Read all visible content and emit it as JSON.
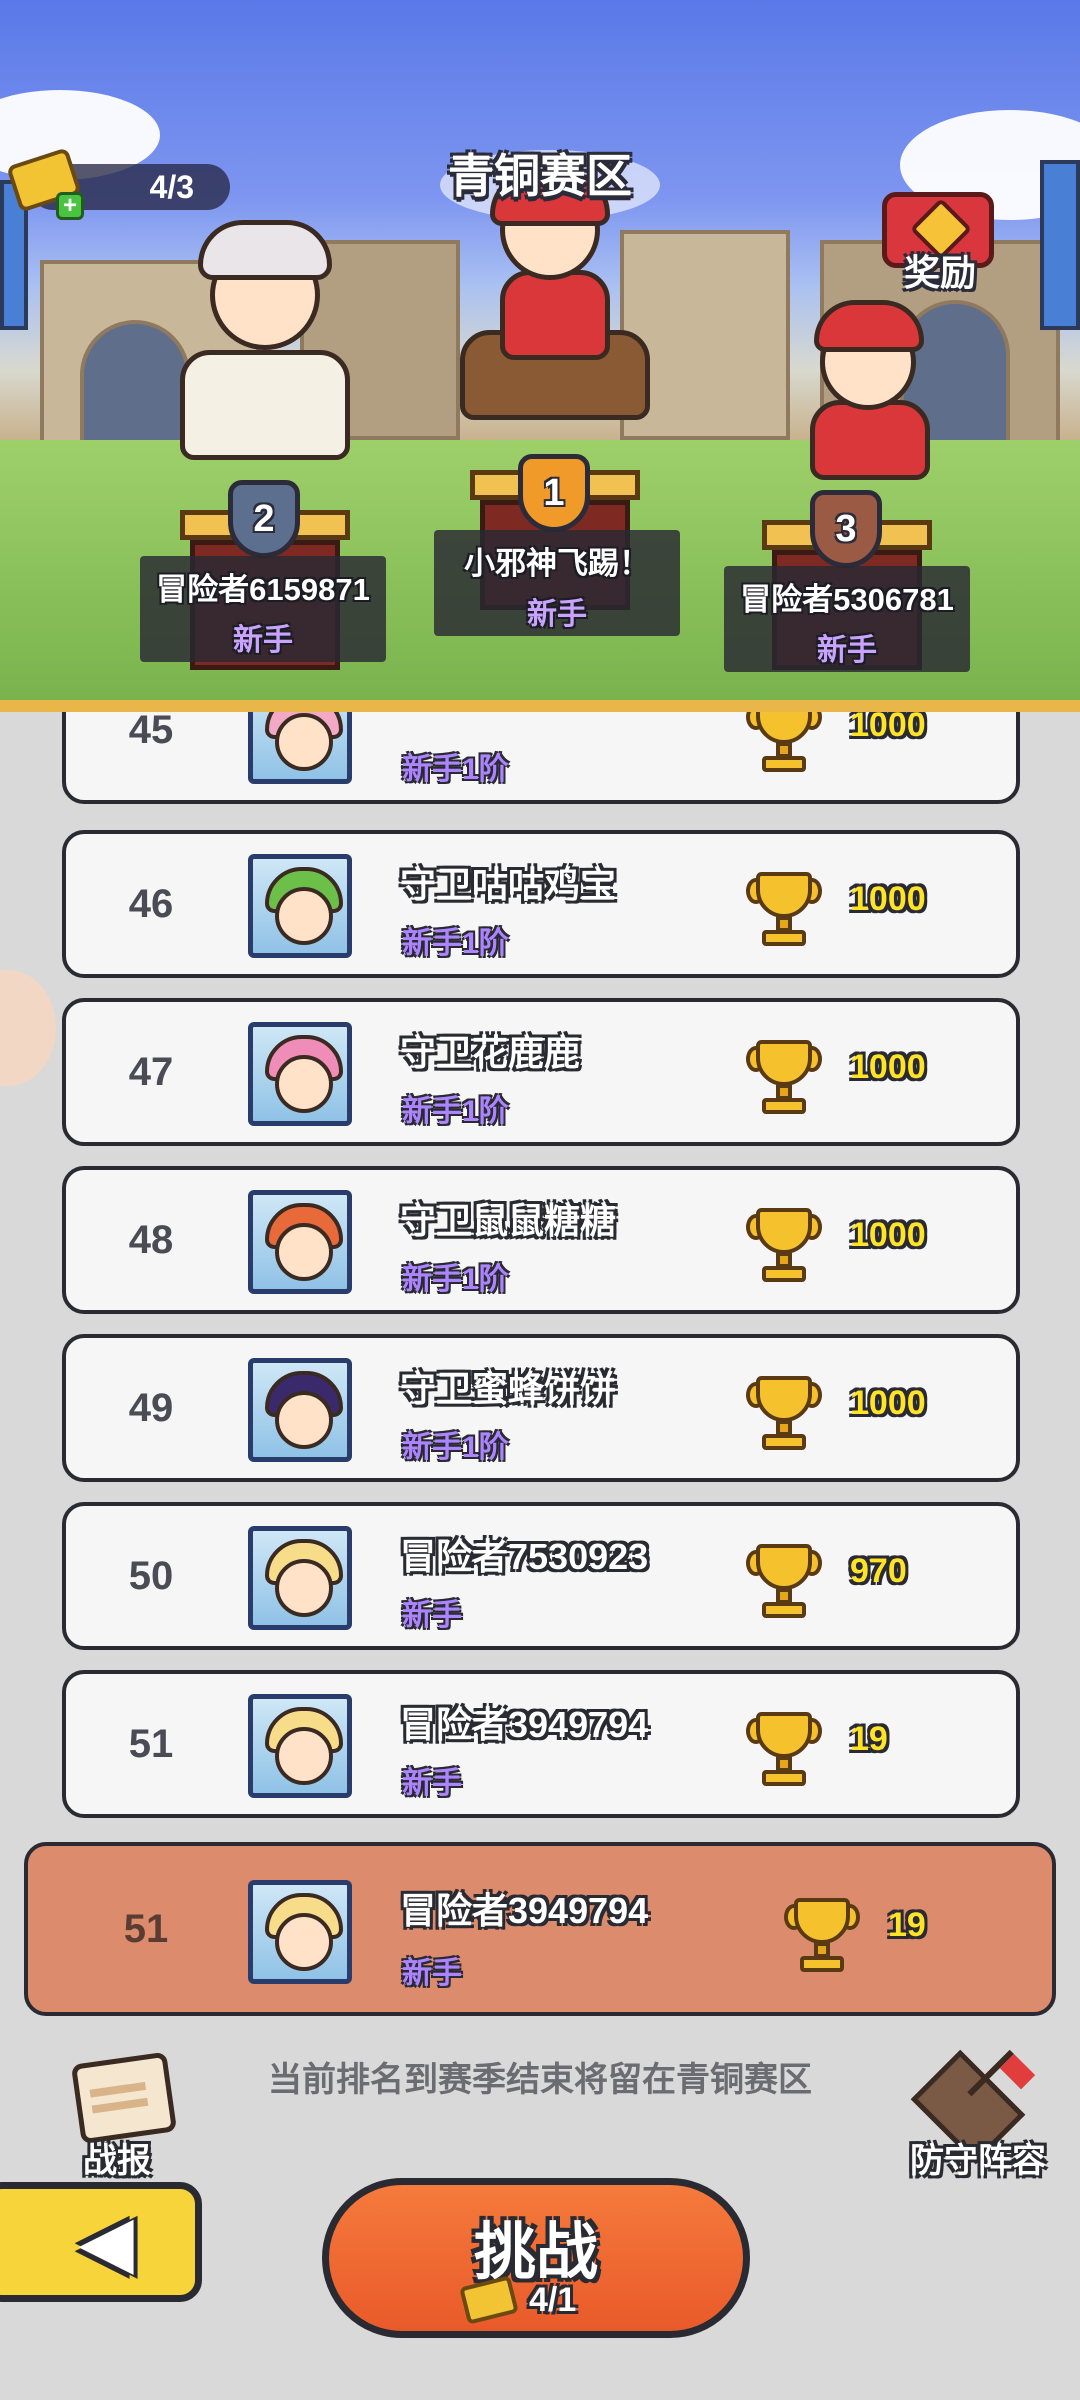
{
  "header": {
    "zone_title": "青铜赛区",
    "tickets": "4/3",
    "reward_label": "奖励"
  },
  "podium": [
    {
      "rank": "2",
      "name": "冒险者6159871",
      "tier": "新手"
    },
    {
      "rank": "1",
      "name": "小邪神飞踢！",
      "tier": "新手"
    },
    {
      "rank": "3",
      "name": "冒险者5306781",
      "tier": "新手"
    }
  ],
  "rows": [
    {
      "rank": "45",
      "name": "",
      "tier": "新手1阶",
      "score": "1000"
    },
    {
      "rank": "46",
      "name": "守卫咕咕鸡宝",
      "tier": "新手1阶",
      "score": "1000"
    },
    {
      "rank": "47",
      "name": "守卫花鹿鹿",
      "tier": "新手1阶",
      "score": "1000"
    },
    {
      "rank": "48",
      "name": "守卫鼠鼠糖糖",
      "tier": "新手1阶",
      "score": "1000"
    },
    {
      "rank": "49",
      "name": "守卫蜜蜂饼饼",
      "tier": "新手1阶",
      "score": "1000"
    },
    {
      "rank": "50",
      "name": "冒险者7530923",
      "tier": "新手",
      "score": "970"
    },
    {
      "rank": "51",
      "name": "冒险者3949794",
      "tier": "新手",
      "score": "19"
    }
  ],
  "self": {
    "rank": "51",
    "name": "冒险者3949794",
    "tier": "新手",
    "score": "19"
  },
  "footer": {
    "notice": "当前排名到赛季结束将留在青铜赛区",
    "report_label": "战报",
    "defense_label": "防守阵容",
    "challenge_label": "挑战",
    "challenge_cost": "4/1"
  },
  "colors": {
    "self_row_bg": "#dc8c6c",
    "challenge_button": "#e95a2a",
    "back_button": "#f6d43a",
    "tier_text": "#ad84ff",
    "score_text": "#ffe326"
  },
  "icons": [
    "ticket-icon",
    "treasure-chest-icon",
    "trophy-icon",
    "scroll-icon",
    "flag-icon",
    "back-arrow-icon"
  ]
}
